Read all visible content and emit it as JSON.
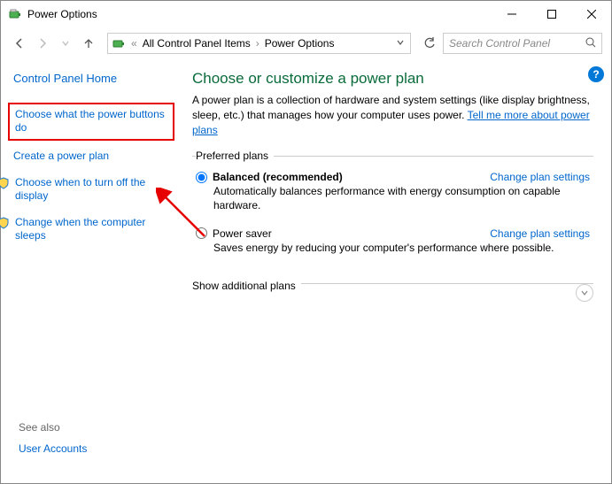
{
  "window": {
    "title": "Power Options"
  },
  "breadcrumb": {
    "parent": "All Control Panel Items",
    "current": "Power Options"
  },
  "search": {
    "placeholder": "Search Control Panel"
  },
  "sidebar": {
    "home": "Control Panel Home",
    "links": [
      "Choose what the power buttons do",
      "Create a power plan",
      "Choose when to turn off the display",
      "Change when the computer sleeps"
    ]
  },
  "see_also": {
    "header": "See also",
    "link": "User Accounts"
  },
  "main": {
    "heading": "Choose or customize a power plan",
    "intro_pre": "A power plan is a collection of hardware and system settings (like display brightness, sleep, etc.) that manages how your computer uses power. ",
    "intro_link": "Tell me more about power plans",
    "plans_legend": "Preferred plans",
    "plans": [
      {
        "name": "Balanced (recommended)",
        "desc": "Automatically balances performance with energy consumption on capable hardware.",
        "change": "Change plan settings",
        "checked": true
      },
      {
        "name": "Power saver",
        "desc": "Saves energy by reducing your computer's performance where possible.",
        "change": "Change plan settings",
        "checked": false
      }
    ],
    "show_additional": "Show additional plans"
  }
}
